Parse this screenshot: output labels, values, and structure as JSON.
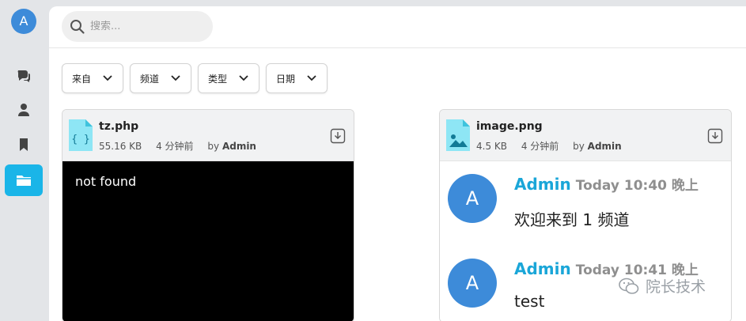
{
  "user": {
    "avatar_letter": "A"
  },
  "rail": {
    "items": [
      {
        "name": "chats",
        "icon": "chat-bubbles-icon"
      },
      {
        "name": "users",
        "icon": "user-icon"
      },
      {
        "name": "saved",
        "icon": "bookmark-icon"
      },
      {
        "name": "files",
        "icon": "folder-icon",
        "active": true
      }
    ]
  },
  "search": {
    "placeholder": "搜索...",
    "value": ""
  },
  "filters": [
    {
      "label": "来自"
    },
    {
      "label": "频道"
    },
    {
      "label": "类型"
    },
    {
      "label": "日期"
    }
  ],
  "files": [
    {
      "name": "tz.php",
      "size": "55.16 KB",
      "age": "4 分钟前",
      "by_prefix": "by",
      "by_user": "Admin",
      "icon": "code-file-icon",
      "preview_text": "not found"
    },
    {
      "name": "image.png",
      "size": "4.5 KB",
      "age": "4 分钟前",
      "by_prefix": "by",
      "by_user": "Admin",
      "icon": "image-file-icon",
      "messages": [
        {
          "avatar_letter": "A",
          "author": "Admin",
          "time": "Today 10:40 晚上",
          "text": "欢迎来到 1 频道"
        },
        {
          "avatar_letter": "A",
          "author": "Admin",
          "time": "Today 10:41 晚上",
          "text": "test"
        }
      ]
    }
  ],
  "watermark": {
    "text": "院长技术"
  },
  "colors": {
    "accent": "#1ab5e8",
    "avatar": "#3d8bd9",
    "author": "#1aa6d8"
  }
}
